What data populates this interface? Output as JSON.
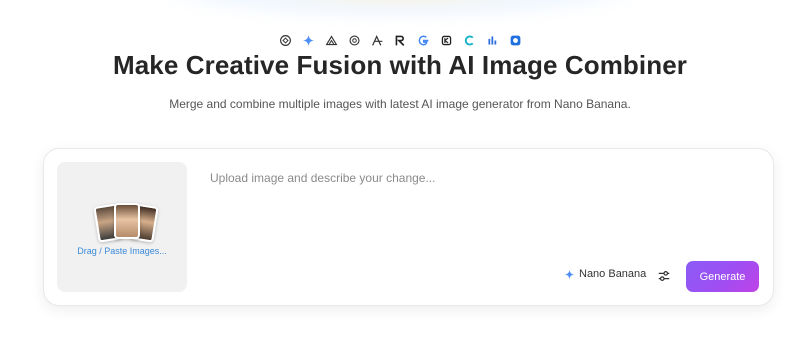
{
  "header": {
    "title": "Make Creative Fusion with AI Image Combiner",
    "subtitle": "Merge and combine multiple images with latest AI image generator from Nano Banana."
  },
  "model_icons": [
    "openai-icon",
    "gemini-spark-icon",
    "midjourney-icon",
    "openai-alt-icon",
    "flux-icon",
    "runway-icon",
    "google-icon",
    "kling-icon",
    "hailuo-icon",
    "seedance-icon",
    "ideogram-icon"
  ],
  "composer": {
    "upload_label": "Drag / Paste Images...",
    "prompt_placeholder": "Upload image and describe your change...",
    "model_name": "Nano Banana",
    "generate_label": "Generate"
  },
  "colors": {
    "accent": "#8b5cf6",
    "upload_label": "#3a8ad6",
    "upload_bg": "#f1f1f1"
  }
}
